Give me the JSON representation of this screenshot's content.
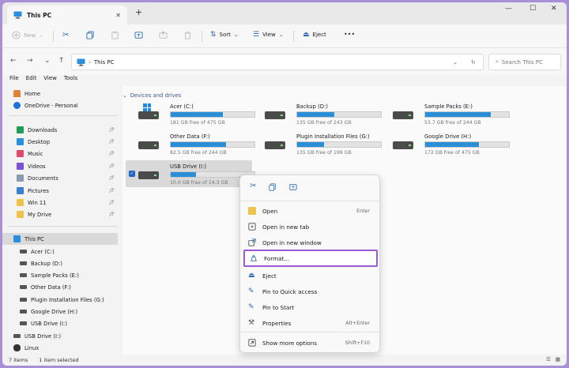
{
  "window": {
    "tab_title": "This PC"
  },
  "toolbar": {
    "new": "New",
    "sort": "Sort",
    "view": "View",
    "eject": "Eject",
    "more": "•••"
  },
  "address": {
    "path": "This PC",
    "search_placeholder": "Search This PC"
  },
  "menu": [
    "File",
    "Edit",
    "View",
    "Tools"
  ],
  "sidebar": {
    "top": [
      "Home",
      "OneDrive - Personal"
    ],
    "quick": [
      "Downloads",
      "Desktop",
      "Music",
      "Videos",
      "Documents",
      "Pictures",
      "Win 11",
      "My Drive"
    ],
    "this_pc": "This PC",
    "drives": [
      "Acer (C:)",
      "Backup (D:)",
      "Sample Packs (E:)",
      "Other Data (F:)",
      "Plugin Installation Files (G:)",
      "Google Drive (H:)",
      "USB Drive (I:)"
    ],
    "bottom": [
      "USB Drive (I:)",
      "Linux"
    ]
  },
  "main": {
    "section": "Devices and drives",
    "drives": [
      {
        "name": "Acer (C:)",
        "free": "181 GB free of 475 GB",
        "used": 0.62
      },
      {
        "name": "Backup (D:)",
        "free": "135 GB free of 243 GB",
        "used": 0.44
      },
      {
        "name": "Sample Packs (E:)",
        "free": "53.7 GB free of 244 GB",
        "used": 0.78
      },
      {
        "name": "Other Data (F:)",
        "free": "82.5 GB free of 244 GB",
        "used": 0.66
      },
      {
        "name": "Plugin Installation Files (G:)",
        "free": "135 GB free of 199 GB",
        "used": 0.32
      },
      {
        "name": "Google Drive (H:)",
        "free": "172 GB free of 475 GB",
        "used": 0.64
      },
      {
        "name": "USB Drive (I:)",
        "free": "10.0 GB free of 14.3 GB",
        "used": 0.3
      }
    ]
  },
  "context_menu": {
    "items": [
      {
        "label": "Open",
        "shortcut": "Enter"
      },
      {
        "label": "Open in new tab",
        "shortcut": ""
      },
      {
        "label": "Open in new window",
        "shortcut": ""
      },
      {
        "label": "Format...",
        "shortcut": ""
      },
      {
        "label": "Eject",
        "shortcut": ""
      },
      {
        "label": "Pin to Quick access",
        "shortcut": ""
      },
      {
        "label": "Pin to Start",
        "shortcut": ""
      },
      {
        "label": "Properties",
        "shortcut": "Alt+Enter"
      },
      {
        "label": "Show more options",
        "shortcut": "Shift+F10"
      }
    ]
  },
  "status": {
    "count": "7 items",
    "selected": "1 item selected"
  }
}
